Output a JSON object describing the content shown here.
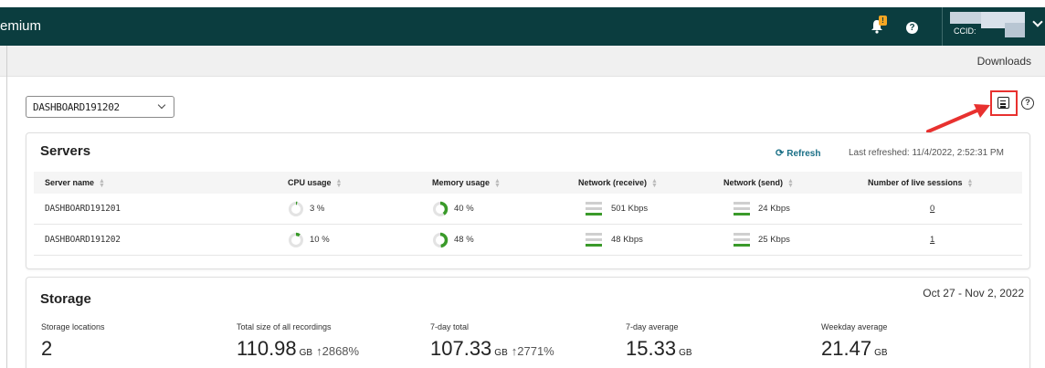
{
  "header": {
    "brand": "emium",
    "notification_count": "!",
    "help": "?",
    "account_ccid_label": "CCID:"
  },
  "subbar": {
    "downloads": "Downloads"
  },
  "site_select": {
    "value": "DASHBOARD191202"
  },
  "help_icon": "?",
  "servers": {
    "title": "Servers",
    "refresh_label": "Refresh",
    "last_refreshed": "Last refreshed: 11/4/2022, 2:52:31 PM",
    "columns": [
      "Server name",
      "CPU usage",
      "Memory usage",
      "Network (receive)",
      "Network (send)",
      "Number of live sessions"
    ],
    "rows": [
      {
        "name": "DASHBOARD191201",
        "cpu": "3 %",
        "cpu_pct": 3,
        "memory": "40 %",
        "memory_pct": 40,
        "net_receive": "501 Kbps",
        "net_send": "24 Kbps",
        "sessions": "0"
      },
      {
        "name": "DASHBOARD191202",
        "cpu": "10 %",
        "cpu_pct": 10,
        "memory": "48 %",
        "memory_pct": 48,
        "net_receive": "48 Kbps",
        "net_send": "25 Kbps",
        "sessions": "1"
      }
    ]
  },
  "storage": {
    "title": "Storage",
    "date_range": "Oct 27 - Nov 2, 2022",
    "stats": [
      {
        "label": "Storage locations",
        "value": "2",
        "unit": "",
        "change": ""
      },
      {
        "label": "Total size of all recordings",
        "value": "110.98",
        "unit": "GB",
        "change": "↑2868%"
      },
      {
        "label": "7-day total",
        "value": "107.33",
        "unit": "GB",
        "change": "↑2771%"
      },
      {
        "label": "7-day average",
        "value": "15.33",
        "unit": "GB",
        "change": ""
      },
      {
        "label": "Weekday average",
        "value": "21.47",
        "unit": "GB",
        "change": ""
      }
    ]
  },
  "colors": {
    "header_bg": "#0b3d3f",
    "accent_green": "#3a9a2a",
    "highlight_red": "#e8312f",
    "link_teal": "#1a6f86"
  }
}
